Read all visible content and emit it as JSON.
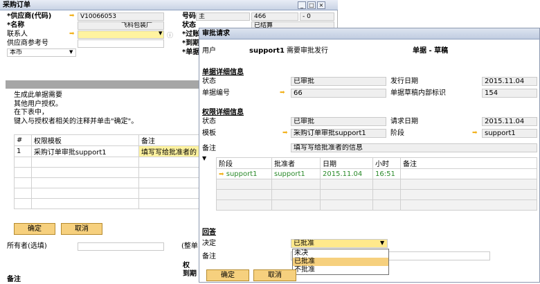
{
  "po": {
    "title": "采购订单",
    "vendor_label": "*供应商(代码)",
    "vendor_code": "V10066053",
    "name_label": "*名称",
    "vendor_name": "飞科包装厂",
    "contact_label": "联系人",
    "vendor_ref_label": "供应商参考号",
    "currency_value": "本币",
    "no_label": "号码",
    "no_series": "主",
    "no_value": "466",
    "no_ext": "- 0",
    "status_label": "状态",
    "status_value": "已结算",
    "posting_label": "*过账",
    "delivery_label": "*到期",
    "doc_label": "*单据",
    "msg_line1": "生成此单据需要",
    "msg_line2": "其他用户授权。",
    "msg_line3": "在下表中，",
    "msg_line4": "键入与授权者相关的注释并单击\"确定\"。",
    "grid_headers": [
      "#",
      "权限模板",
      "备注"
    ],
    "grid_rows": [
      {
        "num": "1",
        "template": "采购订单审批support1",
        "remark": "填写写给批准者的"
      }
    ],
    "ok_label": "确定",
    "cancel_label": "取消",
    "owner_label": "所有者(选填)",
    "total_label": "(整单",
    "rights_label": "权",
    "due_label": "到期",
    "remark_label": "备注"
  },
  "dialog": {
    "title": "审批请求",
    "user_label": "用户",
    "user_value": "support1",
    "user_msg": "需要审批发行",
    "doc_type": "单据 - 草稿",
    "doc_section": "单据详细信息",
    "status_label": "状态",
    "status_value": "已审批",
    "issue_date_label": "发行日期",
    "issue_date_value": "2015.11.04",
    "doc_no_label": "单据编号",
    "doc_no_value": "66",
    "draft_id_label": "单据草稿内部标识",
    "draft_id_value": "154",
    "auth_section": "权限详细信息",
    "auth_status_label": "状态",
    "auth_status_value": "已审批",
    "req_date_label": "请求日期",
    "req_date_value": "2015.11.04",
    "template_label": "模板",
    "template_value": "采购订单审批support1",
    "stage_label": "阶段",
    "stage_value": "support1",
    "remark_label": "备注",
    "remark_value": "填写写给批准者的信息",
    "grid_headers": [
      "阶段",
      "批准者",
      "日期",
      "小时",
      "备注"
    ],
    "grid_rows": [
      {
        "stage": "support1",
        "approver": "support1",
        "date": "2015.11.04",
        "hour": "16:51",
        "remark": ""
      }
    ],
    "answer_section": "回答",
    "decision_label": "决定",
    "decision_value": "已批准",
    "answer_remark_label": "备注",
    "decision_options": [
      "未决",
      "已批准",
      "不批准"
    ],
    "ok_label": "确定",
    "cancel_label": "取消"
  },
  "colors": {
    "button": "#f6d07e",
    "link_arrow": "#f2b11b",
    "row_text_green": "#2a8a2a"
  }
}
